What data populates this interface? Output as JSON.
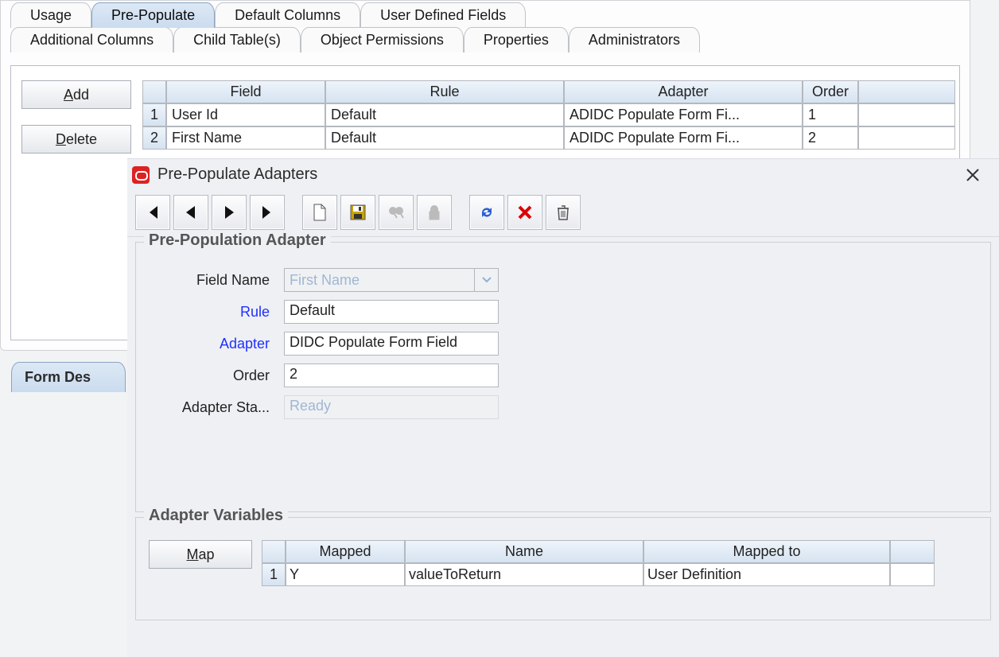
{
  "tabs_row1": [
    {
      "label": "Usage",
      "active": false
    },
    {
      "label": "Pre-Populate",
      "active": true
    },
    {
      "label": "Default Columns",
      "active": false
    },
    {
      "label": "User Defined Fields",
      "active": false
    }
  ],
  "tabs_row2": [
    {
      "label": "Additional Columns"
    },
    {
      "label": "Child Table(s)"
    },
    {
      "label": "Object Permissions"
    },
    {
      "label": "Properties"
    },
    {
      "label": "Administrators"
    }
  ],
  "side_buttons": {
    "add": "Add",
    "delete": "Delete"
  },
  "upper_table": {
    "headers": {
      "field": "Field",
      "rule": "Rule",
      "adapter": "Adapter",
      "order": "Order"
    },
    "rows": [
      {
        "n": "1",
        "field": "User Id",
        "rule": "Default",
        "adapter": "ADIDC Populate Form Fi...",
        "order": "1"
      },
      {
        "n": "2",
        "field": "First Name",
        "rule": "Default",
        "adapter": "ADIDC Populate Form Fi...",
        "order": "2"
      }
    ]
  },
  "dialog": {
    "title": "Pre-Populate Adapters",
    "group1_title": "Pre-Population Adapter",
    "labels": {
      "field_name": "Field Name",
      "rule": "Rule",
      "adapter": "Adapter",
      "order": "Order",
      "adapter_status": "Adapter Sta..."
    },
    "values": {
      "field_name": "First Name",
      "rule": "Default",
      "adapter": "DIDC Populate Form Field",
      "order": "2",
      "adapter_status": "Ready"
    },
    "group2_title": "Adapter Variables",
    "map_button": "Map",
    "var_headers": {
      "mapped": "Mapped",
      "name": "Name",
      "mto": "Mapped to"
    },
    "var_rows": [
      {
        "n": "1",
        "mapped": "Y",
        "name": "valueToReturn",
        "mto": "User Definition"
      }
    ]
  },
  "bottom_tab": "Form Des"
}
